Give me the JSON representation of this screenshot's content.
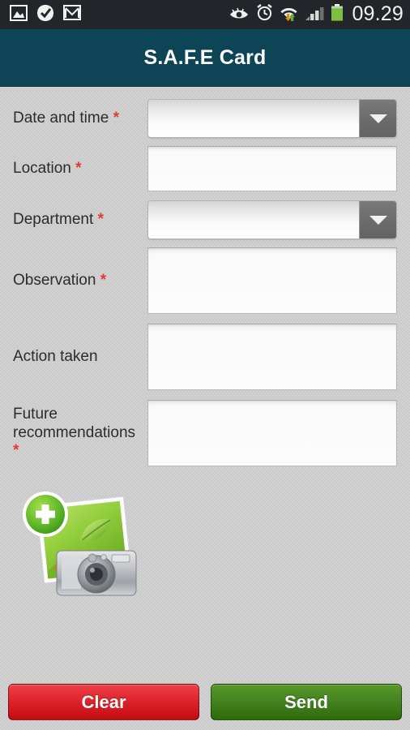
{
  "status_bar": {
    "icons_left": [
      "image-icon",
      "check-circle-icon",
      "gmail-icon"
    ],
    "icons_right": [
      "eye-icon",
      "alarm-clock-icon",
      "wifi-data-icon",
      "signal-bars-icon",
      "battery-icon"
    ],
    "clock": "09.29",
    "background_color": "#22262a",
    "text_color": "#f2f2f2",
    "battery_color": "#7bc043"
  },
  "title_bar": {
    "title": "S.A.F.E Card",
    "background_color": "#0d4456",
    "text_color": "#ffffff"
  },
  "form": {
    "required_marker": "*",
    "required_color": "#e23a37",
    "fields": [
      {
        "label": "Date and time",
        "required": true,
        "type": "spinner",
        "value": ""
      },
      {
        "label": "Location",
        "required": true,
        "type": "text",
        "value": "",
        "placeholder": ""
      },
      {
        "label": "Department",
        "required": true,
        "type": "spinner",
        "value": ""
      },
      {
        "label": "Observation",
        "required": true,
        "type": "textarea",
        "value": "",
        "placeholder": ""
      },
      {
        "label": "Action taken",
        "required": false,
        "type": "textarea",
        "value": "",
        "placeholder": ""
      },
      {
        "label": "Future recommendations",
        "required": true,
        "type": "textarea",
        "value": "",
        "placeholder": ""
      }
    ]
  },
  "attachment": {
    "icon": "add-photo-icon",
    "label": "",
    "badge_icon": "plus-badge-icon",
    "badge_color": "#4aa81c"
  },
  "buttons": {
    "clear_label": "Clear",
    "clear_color": "#d01a21",
    "send_label": "Send",
    "send_color": "#3d7b18"
  }
}
